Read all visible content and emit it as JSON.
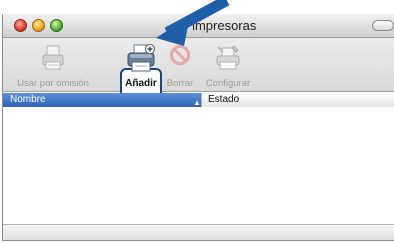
{
  "window": {
    "title": "de impresoras"
  },
  "toolbar": {
    "default_label": "Usar por omisión",
    "add_label": "Añadir",
    "delete_label": "Borrar",
    "configure_label": "Configurar"
  },
  "table": {
    "columns": [
      "Nombre",
      "Estado"
    ]
  },
  "colors": {
    "arrow": "#1f5fa8",
    "selected_header": "#2e63b6",
    "highlight_border": "#18467e"
  },
  "icons": {
    "default": "printer-disabled-icon",
    "add": "printer-add-icon",
    "delete": "delete-icon",
    "configure": "configure-printer-icon",
    "pointer": "pointer-arrow-icon"
  }
}
